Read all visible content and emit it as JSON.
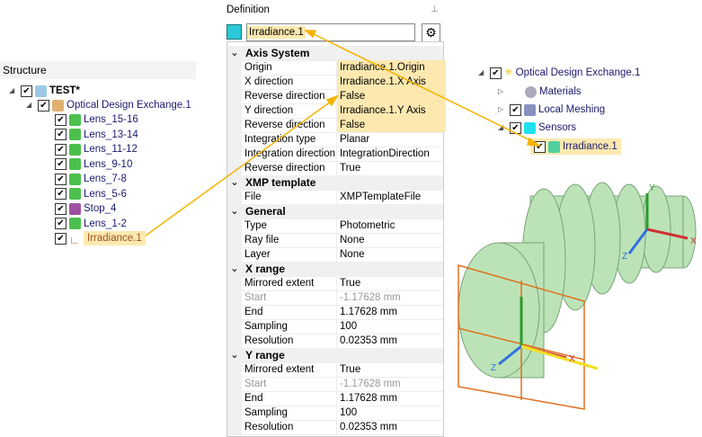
{
  "structure": {
    "title": "Structure",
    "root": "TEST*",
    "assembly": "Optical Design Exchange.1",
    "items": [
      {
        "label": "Lens_15-16",
        "icon": "lens-icon"
      },
      {
        "label": "Lens_13-14",
        "icon": "lens-icon"
      },
      {
        "label": "Lens_11-12",
        "icon": "lens-icon"
      },
      {
        "label": "Lens_9-10",
        "icon": "lens-icon"
      },
      {
        "label": "Lens_7-8",
        "icon": "lens-icon"
      },
      {
        "label": "Lens_5-6",
        "icon": "lens-icon"
      },
      {
        "label": "Stop_4",
        "icon": "stop-icon"
      },
      {
        "label": "Lens_1-2",
        "icon": "lens-icon"
      },
      {
        "label": "Irradiance.1",
        "icon": "axis-icon"
      }
    ]
  },
  "definition": {
    "title": "Definition",
    "name_value": "Irradiance.1",
    "rows": [
      {
        "type": "section",
        "label": "Axis System"
      },
      {
        "label": "Origin",
        "value": "Irradiance.1.Origin",
        "hl": true
      },
      {
        "label": "X direction",
        "value": "Irradiance.1.X Axis",
        "hl": true
      },
      {
        "label": "Reverse direction",
        "value": "False",
        "hl": true
      },
      {
        "label": "Y direction",
        "value": "Irradiance.1.Y Axis",
        "hl": true
      },
      {
        "label": "Reverse direction",
        "value": "False",
        "hl": true
      },
      {
        "label": "Integration type",
        "value": "Planar"
      },
      {
        "label": "Integration direction",
        "value": "IntegrationDirection"
      },
      {
        "label": "Reverse direction",
        "value": "True"
      },
      {
        "type": "section",
        "label": "XMP template"
      },
      {
        "label": "File",
        "value": "XMPTemplateFile"
      },
      {
        "type": "section",
        "label": "General"
      },
      {
        "label": "Type",
        "value": "Photometric"
      },
      {
        "label": "Ray file",
        "value": "None"
      },
      {
        "label": "Layer",
        "value": "None"
      },
      {
        "type": "section",
        "label": "X range"
      },
      {
        "label": "Mirrored extent",
        "value": "True"
      },
      {
        "label": "Start",
        "value": "-1.17628 mm",
        "disabled": true
      },
      {
        "label": "End",
        "value": "1.17628 mm"
      },
      {
        "label": "Sampling",
        "value": "100"
      },
      {
        "label": "Resolution",
        "value": "0.02353 mm"
      },
      {
        "type": "section",
        "label": "Y range"
      },
      {
        "label": "Mirrored extent",
        "value": "True"
      },
      {
        "label": "Start",
        "value": "-1.17628 mm",
        "disabled": true
      },
      {
        "label": "End",
        "value": "1.17628 mm"
      },
      {
        "label": "Sampling",
        "value": "100"
      },
      {
        "label": "Resolution",
        "value": "0.02353 mm"
      }
    ]
  },
  "sim_tree": {
    "root": "Optical Design Exchange.1",
    "items": [
      "Materials",
      "Local Meshing",
      "Sensors",
      "Irradiance.1"
    ]
  },
  "viewport": {
    "axis_labels": {
      "x": "X",
      "y": "Y",
      "z": "Z"
    }
  },
  "colors": {
    "highlight": "#fde9b0",
    "arrow": "#f5b400",
    "lens": "#a8d8a0",
    "sensor": "#e07020"
  }
}
